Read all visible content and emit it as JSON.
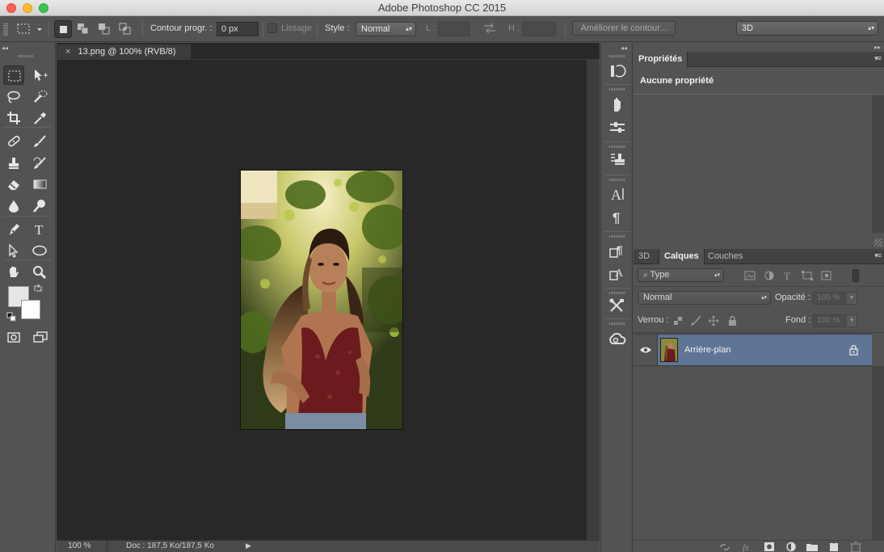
{
  "window": {
    "title": "Adobe Photoshop CC 2015",
    "traffic_lights": {
      "close": "#fc5f57",
      "minimize": "#fdbc2e",
      "zoom": "#34c84a"
    }
  },
  "options_bar": {
    "feather_label": "Contour progr. :",
    "feather_value": "0 px",
    "antialias_label": "Lissage",
    "style_label": "Style :",
    "style_value": "Normal",
    "width_label": "L :",
    "height_label": "H :",
    "refine_edge_button": "Améliorer le contour...",
    "workspace_value": "3D"
  },
  "document": {
    "tab_label": "13.png @ 100% (RVB/8)",
    "close_glyph": "×",
    "zoom": "100 %",
    "doc_info": "Doc : 187,5 Ko/187,5 Ko",
    "canvas_bg": "#282828"
  },
  "tools": [
    "rectangular-marquee",
    "move",
    "lasso",
    "quick-selection",
    "crop",
    "eyedropper",
    "spot-healing-brush",
    "brush",
    "clone-stamp",
    "history-brush",
    "eraser",
    "gradient",
    "blur",
    "dodge",
    "pen",
    "type",
    "path-selection",
    "ellipse",
    "hand",
    "zoom",
    "swap-colors",
    "default-colors",
    "quick-mask",
    "screen-mode"
  ],
  "dock_icons": [
    "history-icon",
    "cursor-hand-icon",
    "adjust-icon",
    "stamp-list-icon",
    "character-icon",
    "paragraph-icon",
    "paragraph-styles-icon",
    "character-styles-icon",
    "tools-presets-icon",
    "creative-cloud-icon"
  ],
  "properties_panel": {
    "tab": "Propriétés",
    "message": "Aucune propriété"
  },
  "layers_panel": {
    "tabs": [
      "3D",
      "Calques",
      "Couches"
    ],
    "active_tab": "Calques",
    "filter_kind": "Type",
    "blend_mode": "Normal",
    "opacity_label": "Opacité :",
    "opacity_value": "100 %",
    "lock_label": "Verrou :",
    "fill_label": "Fond :",
    "fill_value": "100 %",
    "layers": [
      {
        "name": "Arrière-plan",
        "visible": true,
        "locked": true,
        "selected": true
      }
    ],
    "selected_color": "#5f7595"
  }
}
